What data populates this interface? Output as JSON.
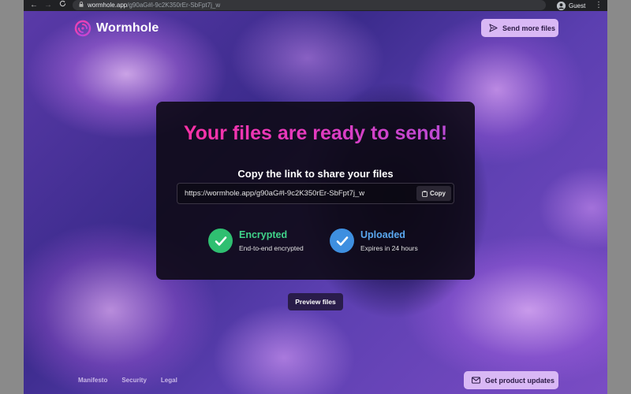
{
  "browser": {
    "url_host": "wormhole.app",
    "url_path": "/g90aG#l-9c2K350rEr-SbFpt7j_w",
    "profile_name": "Guest",
    "back_icon": "←",
    "forward_icon": "→",
    "reload_icon": "C",
    "lock_icon": "🔒",
    "menu_icon": "⋮"
  },
  "header": {
    "logo_text": "Wormhole",
    "send_more_label": "Send more files"
  },
  "card": {
    "headline": "Your files are ready to send!",
    "share_label": "Copy the link to share your files",
    "link": "https://wormhole.app/g90aG#l-9c2K350rEr-SbFpt7j_w",
    "copy_label": "Copy",
    "encrypted": {
      "title": "Encrypted",
      "subtitle": "End-to-end encrypted"
    },
    "uploaded": {
      "title": "Uploaded",
      "subtitle": "Expires in 24 hours"
    }
  },
  "preview_label": "Preview files",
  "footer": {
    "links": [
      "Manifesto",
      "Security",
      "Legal"
    ],
    "updates_label": "Get product updates"
  },
  "colors": {
    "accent_pink": "#ff2fa0",
    "accent_purple": "#b24ed9",
    "encrypted_green": "#2fbf71",
    "uploaded_blue": "#3e8fe0",
    "pill_bg": "#d9b8f5"
  }
}
